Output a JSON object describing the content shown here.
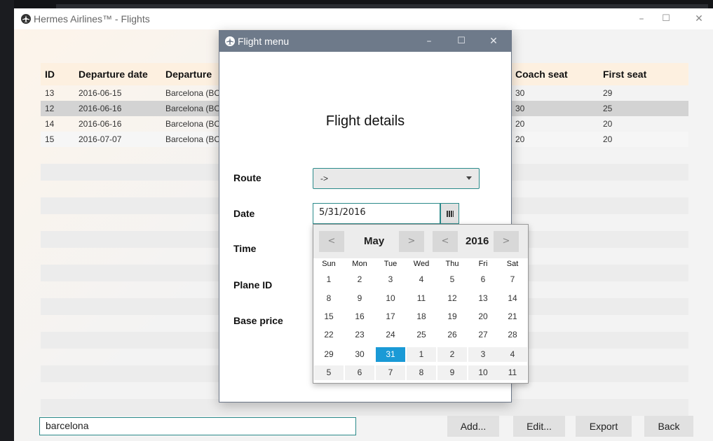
{
  "window": {
    "title": "Hermes Airlines™  -  Flights",
    "controls": {
      "minimize": "–",
      "maximize": "☐",
      "close": "✕"
    }
  },
  "table": {
    "columns": {
      "id": "ID",
      "departure_date": "Departure date",
      "departure": "Departure",
      "coach_seat": "Coach seat",
      "first_seat": "First seat"
    },
    "rows": [
      {
        "id": "13",
        "departure_date": "2016-06-15",
        "departure": "Barcelona (BC",
        "coach_seat": "30",
        "first_seat": "29"
      },
      {
        "id": "12",
        "departure_date": "2016-06-16",
        "departure": "Barcelona (BC",
        "coach_seat": "30",
        "first_seat": "25"
      },
      {
        "id": "14",
        "departure_date": "2016-06-16",
        "departure": "Barcelona (BC",
        "coach_seat": "20",
        "first_seat": "20"
      },
      {
        "id": "15",
        "departure_date": "2016-07-07",
        "departure": "Barcelona (BC",
        "coach_seat": "20",
        "first_seat": "20"
      }
    ],
    "selected_row_id": "12"
  },
  "search": {
    "value": "barcelona"
  },
  "buttons": {
    "add": "Add...",
    "edit": "Edit...",
    "export": "Export",
    "back": "Back"
  },
  "dialog": {
    "title": "Flight menu",
    "heading": "Flight details",
    "controls": {
      "minimize": "–",
      "maximize": "☐",
      "close": "✕"
    },
    "labels": {
      "route": "Route",
      "date": "Date",
      "time": "Time",
      "plane_id": "Plane ID",
      "base_price": "Base price"
    },
    "route_value": "->",
    "date_value": "5/31/2016"
  },
  "calendar": {
    "month": "May",
    "year": "2016",
    "prev": "<",
    "next": ">",
    "weekdays": [
      "Sun",
      "Mon",
      "Tue",
      "Wed",
      "Thu",
      "Fri",
      "Sat"
    ],
    "weeks": [
      [
        "1",
        "2",
        "3",
        "4",
        "5",
        "6",
        "7"
      ],
      [
        "8",
        "9",
        "10",
        "11",
        "12",
        "13",
        "14"
      ],
      [
        "15",
        "16",
        "17",
        "18",
        "19",
        "20",
        "21"
      ],
      [
        "22",
        "23",
        "24",
        "25",
        "26",
        "27",
        "28"
      ],
      [
        "29",
        "30",
        "31",
        "1",
        "2",
        "3",
        "4"
      ],
      [
        "5",
        "6",
        "7",
        "8",
        "9",
        "10",
        "11"
      ]
    ],
    "selected_day": "31"
  },
  "colors": {
    "accent": "#1a9ad6",
    "dialog_titlebar": "#6e7a8a",
    "focus_border": "#2a8a8a",
    "header_bg": "#fdf0e0"
  },
  "icons": {
    "app": "plane-icon",
    "calendar_button": "calendar-icon"
  }
}
